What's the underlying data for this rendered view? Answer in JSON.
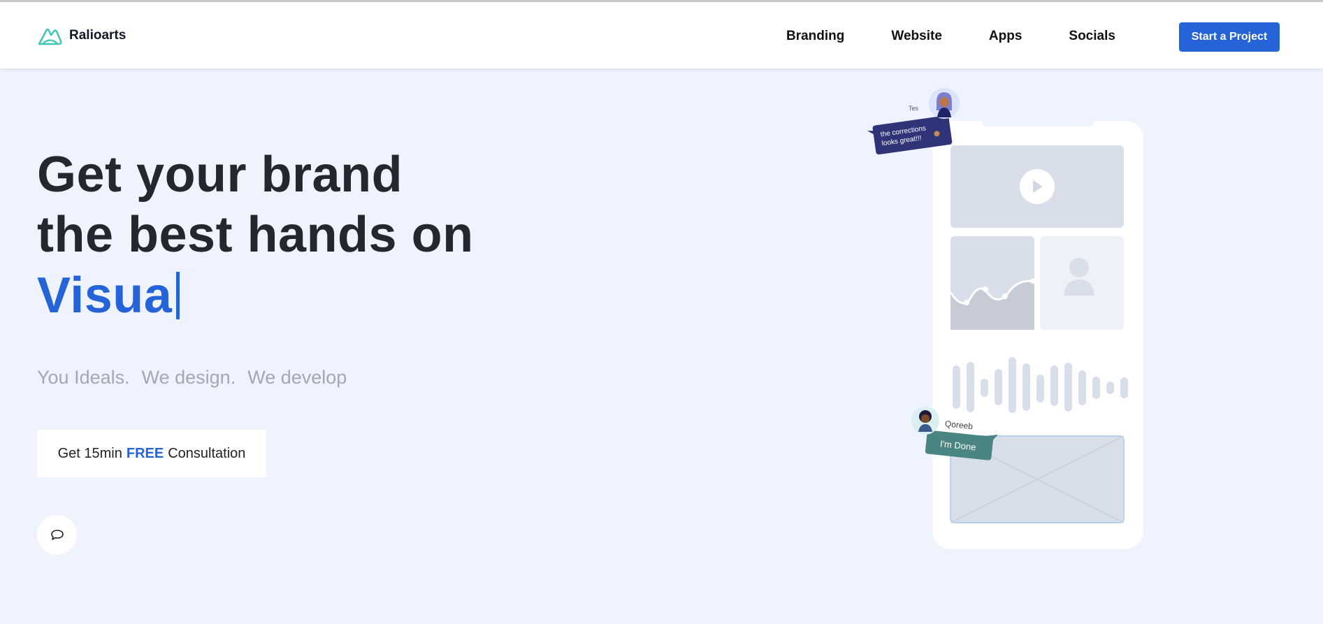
{
  "brand": {
    "name": "Ralioarts",
    "logo_icon": "mountain-logo-icon",
    "logo_color": "#3cc8b4"
  },
  "nav": {
    "links": [
      {
        "label": "Branding"
      },
      {
        "label": "Website"
      },
      {
        "label": "Apps"
      },
      {
        "label": "Socials"
      }
    ],
    "cta_label": "Start a Project"
  },
  "hero": {
    "line1": "Get your brand",
    "line2": "the best hands on",
    "typed": "Visua",
    "tagline": [
      "You Ideals.",
      "We design.",
      "We develop"
    ],
    "consult": {
      "prefix": "Get 15min",
      "free": "FREE",
      "suffix": "Consultation"
    },
    "chat_icon": "chat-bubble-icon"
  },
  "illustration": {
    "bubble_top": {
      "name": "Tes",
      "message_line1": "the corrections",
      "message_line2": "looks great!!!"
    },
    "bubble_bottom": {
      "name": "Qoreeb",
      "message": "I'm Done"
    }
  },
  "colors": {
    "accent": "#2563d9",
    "background": "#eef3fd",
    "bubble_dark": "#2f3478",
    "bubble_teal": "#4a8582"
  }
}
